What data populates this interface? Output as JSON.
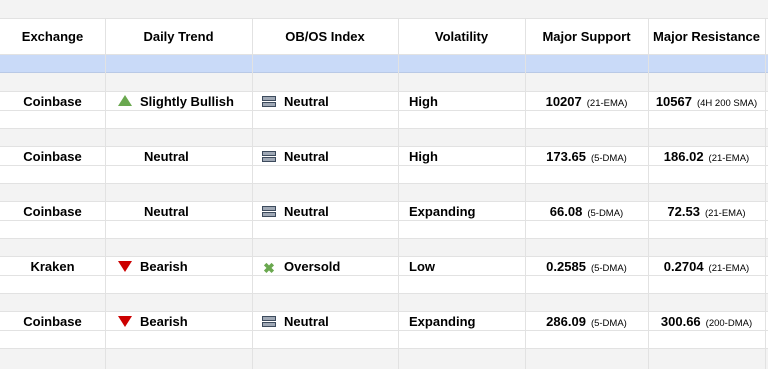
{
  "headers": {
    "exchange": "Exchange",
    "trend": "Daily Trend",
    "obos": "OB/OS Index",
    "volatility": "Volatility",
    "support": "Major Support",
    "resistance": "Major Resistance"
  },
  "rows": [
    {
      "exchange": "Coinbase",
      "trend": "Slightly Bullish",
      "trend_icon": "triangle-up-green-icon",
      "obos": "Neutral",
      "obos_icon": "neutral-bars-icon",
      "volatility": "High",
      "support_value": "10207",
      "support_note": "(21-EMA)",
      "resistance_value": "10567",
      "resistance_note": "(4H 200 SMA)"
    },
    {
      "exchange": "Coinbase",
      "trend": "Neutral",
      "trend_icon": "",
      "obos": "Neutral",
      "obos_icon": "neutral-bars-icon",
      "volatility": "High",
      "support_value": "173.65",
      "support_note": "(5-DMA)",
      "resistance_value": "186.02",
      "resistance_note": "(21-EMA)"
    },
    {
      "exchange": "Coinbase",
      "trend": "Neutral",
      "trend_icon": "",
      "obos": "Neutral",
      "obos_icon": "neutral-bars-icon",
      "volatility": "Expanding",
      "support_value": "66.08",
      "support_note": "(5-DMA)",
      "resistance_value": "72.53",
      "resistance_note": "(21-EMA)"
    },
    {
      "exchange": "Kraken",
      "trend": "Bearish",
      "trend_icon": "triangle-down-red-icon",
      "obos": "Oversold",
      "obos_icon": "x-mark-green-icon",
      "volatility": "Low",
      "support_value": "0.2585",
      "support_note": "(5-DMA)",
      "resistance_value": "0.2704",
      "resistance_note": "(21-EMA)"
    },
    {
      "exchange": "Coinbase",
      "trend": "Bearish",
      "trend_icon": "triangle-down-red-icon",
      "obos": "Neutral",
      "obos_icon": "neutral-bars-icon",
      "volatility": "Expanding",
      "support_value": "286.09",
      "support_note": "(5-DMA)",
      "resistance_value": "300.66",
      "resistance_note": "(200-DMA)"
    }
  ],
  "colors": {
    "header_band": "#c9daf8",
    "stripe": "#f3f3f3",
    "gridline": "#e2e2e2",
    "bullish": "#6aa84f",
    "bearish": "#cc0000"
  }
}
